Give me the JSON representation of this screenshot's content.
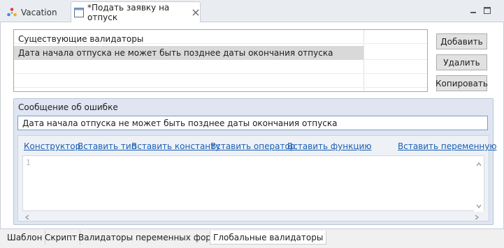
{
  "tabs": {
    "vacation": "Vacation",
    "active": "*Подать заявку на отпуск"
  },
  "validators": {
    "header": "Существующие валидаторы",
    "rows": [
      "Дата начала отпуска не может быть позднее даты окончания отпуска"
    ]
  },
  "buttons": {
    "add": "Добавить",
    "delete": "Удалить",
    "copy": "Копировать"
  },
  "error": {
    "label": "Сообщение об ошибке",
    "value": "Дата начала отпуска не может быть позднее даты окончания отпуска"
  },
  "toolbar": {
    "constructor": "Конструктор",
    "insert_type": "Вставить тип",
    "insert_constant": "Вставить константу",
    "insert_operator": "Вставить оператор",
    "insert_function": "Вставить функцию",
    "insert_variable": "Вставить переменную"
  },
  "editor": {
    "line_number": "1"
  },
  "page_tabs": [
    "Шаблон",
    "Скрипт",
    "Валидаторы переменных формы",
    "Глобальные валидаторы"
  ],
  "active_page_tab": "Глобальные валидаторы",
  "colors": {
    "link": "#1a5fb4",
    "group_bg": "#dfe6f2",
    "selected_row": "#d9d9d9"
  }
}
